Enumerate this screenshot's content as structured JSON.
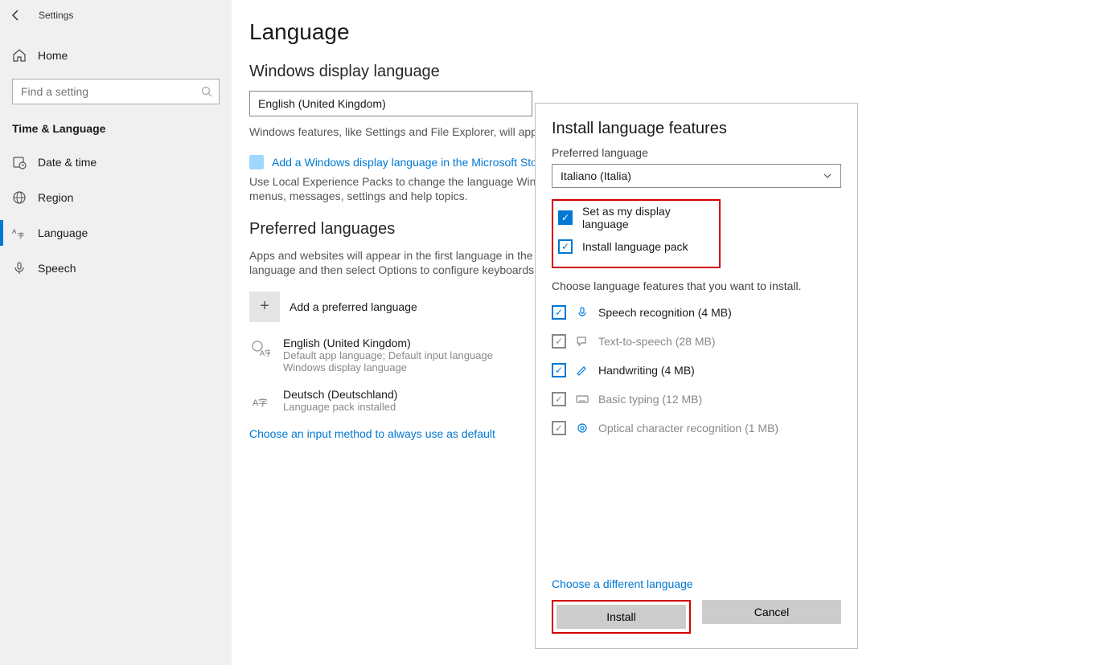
{
  "header": {
    "app_title": "Settings"
  },
  "sidebar": {
    "home_label": "Home",
    "search_placeholder": "Find a setting",
    "section_label": "Time & Language",
    "items": [
      {
        "label": "Date & time"
      },
      {
        "label": "Region"
      },
      {
        "label": "Language"
      },
      {
        "label": "Speech"
      }
    ]
  },
  "main": {
    "page_title": "Language",
    "display_section_title": "Windows display language",
    "display_language_value": "English (United Kingdom)",
    "display_helper_1": "Windows features, like Settings and File Explorer, will appear in this language.",
    "store_link": "Add a Windows display language in the Microsoft Store",
    "store_helper": "Use Local Experience Packs to change the language Windows uses for navigation, menus, messages, settings and help topics.",
    "preferred_section_title": "Preferred languages",
    "preferred_helper": "Apps and websites will appear in the first language in the list that they support. Select a language and then select Options to configure keyboards and other features.",
    "add_preferred_label": "Add a preferred language",
    "languages": [
      {
        "name": "English (United Kingdom)",
        "sub1": "Default app language; Default input language",
        "sub2": "Windows display language"
      },
      {
        "name": "Deutsch (Deutschland)",
        "sub1": "Language pack installed",
        "sub2": ""
      }
    ],
    "input_method_link": "Choose an input method to always use as default"
  },
  "modal": {
    "title": "Install language features",
    "pref_label": "Preferred language",
    "selected_language": "Italiano (Italia)",
    "set_display_label": "Set as my display language",
    "install_pack_label": "Install language pack",
    "choose_text": "Choose language features that you want to install.",
    "features": [
      {
        "label": "Speech recognition (4 MB)",
        "checked": true,
        "disabled": false
      },
      {
        "label": "Text-to-speech (28 MB)",
        "checked": true,
        "disabled": true
      },
      {
        "label": "Handwriting (4 MB)",
        "checked": true,
        "disabled": false
      },
      {
        "label": "Basic typing (12 MB)",
        "checked": true,
        "disabled": true
      },
      {
        "label": "Optical character recognition (1 MB)",
        "checked": true,
        "disabled": true
      }
    ],
    "choose_diff_link": "Choose a different language",
    "install_btn": "Install",
    "cancel_btn": "Cancel"
  }
}
